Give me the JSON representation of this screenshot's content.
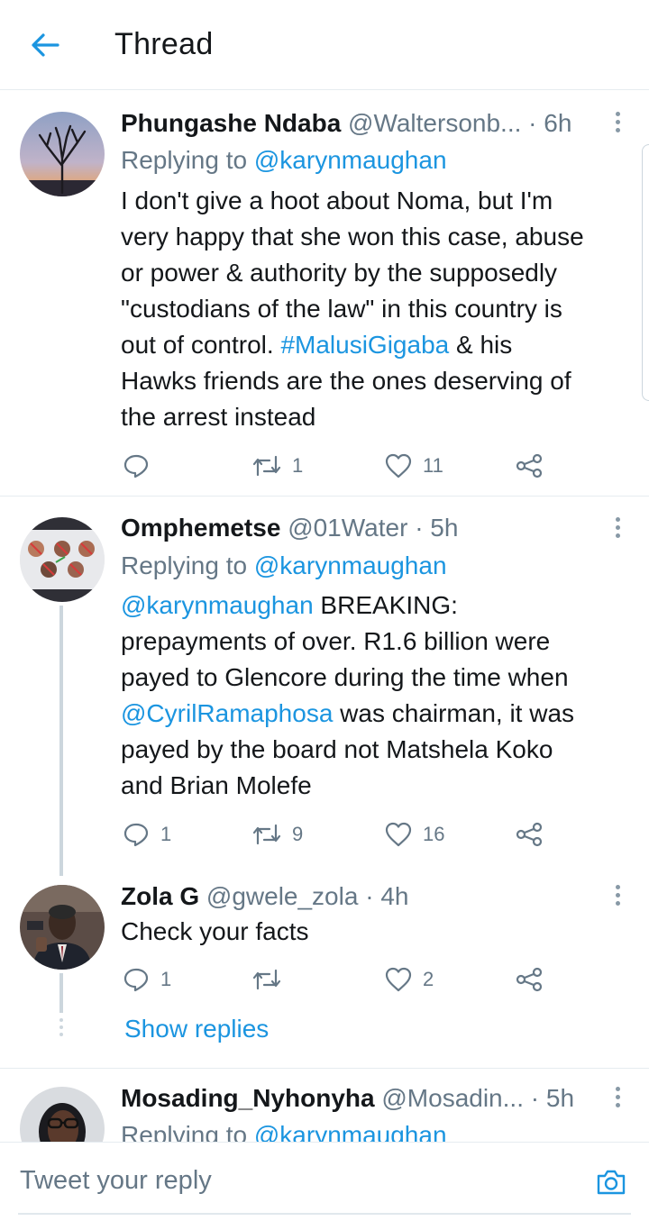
{
  "header": {
    "title": "Thread",
    "back_icon": "arrow-left-icon"
  },
  "colors": {
    "accent": "#1b95e0",
    "secondary_text": "#657786",
    "primary_text": "#14171a"
  },
  "tweets": [
    {
      "display_name": "Phungashe Ndaba",
      "handle": "@Waltersonb...",
      "time": "· 6h",
      "replying_label": "Replying to",
      "replying_handle": "@karynmaughan",
      "body_lines": [
        "I don't give a hoot about Noma, but I'm",
        "very happy that she won this case, abuse",
        "or power & authority by the supposedly",
        "\"custodians of the law\" in this country is",
        "out of control. ",
        "Hawks friends are the ones deserving of",
        "the arrest instead"
      ],
      "hashtag": "#MalusiGigaba",
      "after_hashtag": " & his",
      "reply_count": "",
      "retweet_count": "1",
      "like_count": "11"
    },
    {
      "display_name": "Omphemetse",
      "handle": "@01Water",
      "time": "· 5h",
      "replying_label": "Replying to",
      "replying_handle": "@karynmaughan",
      "mention_1": "@karynmaughan",
      "line_1_rest": " BREAKING:",
      "line_2": "prepayments of over. R1.6 billion were",
      "line_3": "payed to Glencore during the time when",
      "mention_2": "@CyrilRamaphosa",
      "line_4_rest": " was chairman, it was",
      "line_5": "payed by the board not Matshela Koko",
      "line_6": "and Brian Molefe",
      "reply_count": "1",
      "retweet_count": "9",
      "like_count": "16"
    },
    {
      "display_name": "Zola G",
      "handle": "@gwele_zola",
      "time": "· 4h",
      "body": "Check your facts",
      "reply_count": "1",
      "retweet_count": "",
      "like_count": "2",
      "show_replies": "Show replies"
    },
    {
      "display_name": "Mosading_Nyhonyha",
      "handle": "@Mosadin...",
      "time": "· 5h",
      "replying_label": "Replying to",
      "replying_handle": "@karynmaughan"
    }
  ],
  "reply_bar": {
    "placeholder": "Tweet your reply",
    "camera_icon": "camera-icon"
  }
}
